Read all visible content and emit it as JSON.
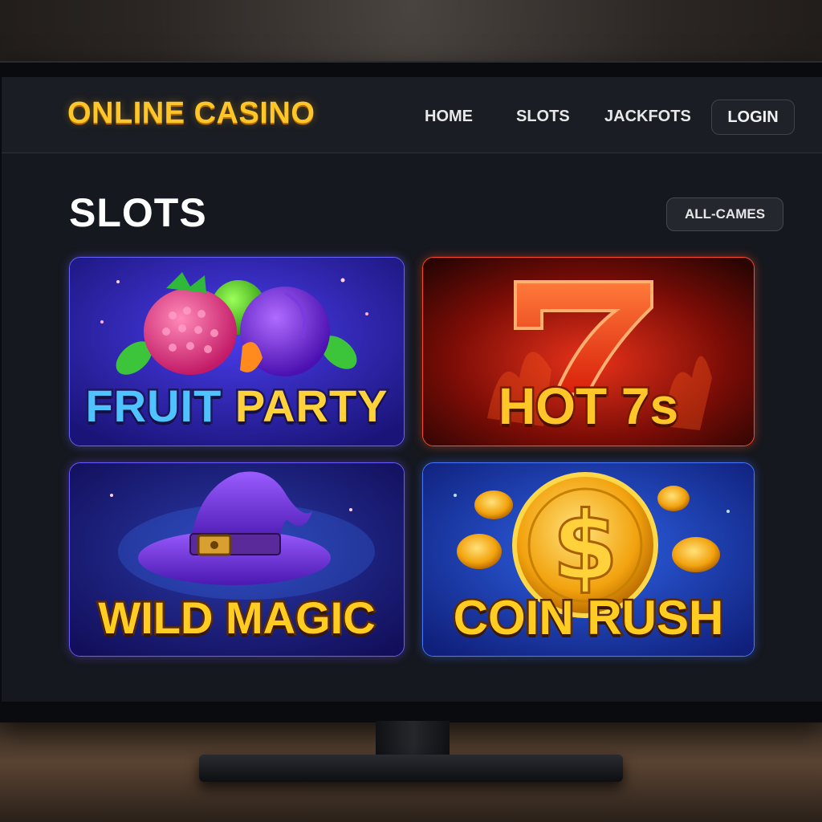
{
  "site": {
    "logo_text": "ONLINE CASINO"
  },
  "nav": {
    "links": [
      {
        "label": "HOME"
      },
      {
        "label": "SLOTS"
      },
      {
        "label": "JACKFOTS"
      }
    ],
    "login_label": "LOGIN"
  },
  "main": {
    "section_title": "SLOTS",
    "all_games_label": "ALL-CAMES",
    "games": [
      {
        "title_part1": "FRUIT",
        "title_part2": "PARTY",
        "accent": "#6a62ff",
        "icon": "fruit-icon"
      },
      {
        "title": "HOT 7s",
        "accent": "#ff4a2a",
        "icon": "seven-icon"
      },
      {
        "title": "WILD MAGIC",
        "accent": "#6a5cff",
        "icon": "wizard-hat-icon"
      },
      {
        "title": "COIN RUSH",
        "accent": "#4a78ff",
        "icon": "dollar-coin-icon"
      }
    ]
  },
  "colors": {
    "logo": "#ffc629",
    "screen_bg": "#15181e",
    "navbar_bg": "#1a1d23"
  }
}
